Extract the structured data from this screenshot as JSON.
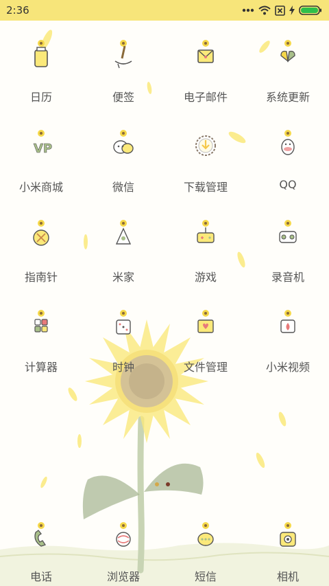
{
  "status": {
    "time": "2:36",
    "bar_color": "#f7e57a",
    "icons": [
      "dots-icon",
      "wifi-icon",
      "no-sim-icon",
      "charging-icon",
      "battery-icon"
    ]
  },
  "apps": [
    {
      "label": "日历",
      "icon": "calendar-icon"
    },
    {
      "label": "便签",
      "icon": "notes-icon"
    },
    {
      "label": "电子邮件",
      "icon": "email-icon"
    },
    {
      "label": "系统更新",
      "icon": "update-icon"
    },
    {
      "label": "小米商城",
      "icon": "mi-store-icon"
    },
    {
      "label": "微信",
      "icon": "wechat-icon"
    },
    {
      "label": "下载管理",
      "icon": "download-icon"
    },
    {
      "label": "QQ",
      "icon": "qq-icon"
    },
    {
      "label": "指南针",
      "icon": "compass-icon"
    },
    {
      "label": "米家",
      "icon": "mijia-icon"
    },
    {
      "label": "游戏",
      "icon": "game-icon"
    },
    {
      "label": "录音机",
      "icon": "recorder-icon"
    },
    {
      "label": "计算器",
      "icon": "calculator-icon"
    },
    {
      "label": "时钟",
      "icon": "clock-icon"
    },
    {
      "label": "文件管理",
      "icon": "file-manager-icon"
    },
    {
      "label": "小米视频",
      "icon": "video-icon"
    }
  ],
  "dock": [
    {
      "label": "电话",
      "icon": "phone-icon"
    },
    {
      "label": "浏览器",
      "icon": "browser-icon"
    },
    {
      "label": "短信",
      "icon": "sms-icon"
    },
    {
      "label": "相机",
      "icon": "camera-icon"
    }
  ],
  "colors": {
    "label": "#555555",
    "accent_yellow": "#f5d84a",
    "petal": "#fbe97a",
    "leaf": "#9fb08a"
  }
}
